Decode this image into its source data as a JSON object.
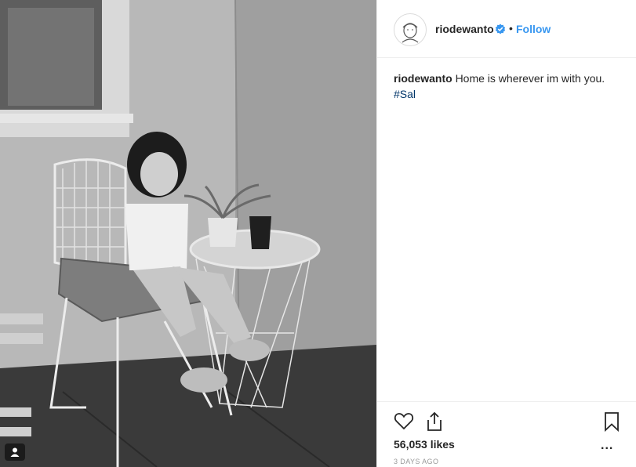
{
  "post": {
    "username": "riodewanto",
    "follow_label": "Follow",
    "separator": "•",
    "caption_text": "Home is wherever im with you.",
    "hashtag": "#Sal",
    "likes": "56,053 likes",
    "time_ago": "3 DAYS AGO",
    "more_label": "..."
  },
  "icons": {
    "verified": "verified-badge-icon",
    "like": "heart-icon",
    "share": "share-icon",
    "save": "bookmark-icon",
    "tag": "user-tag-icon"
  },
  "colors": {
    "link": "#3897f0",
    "hashtag": "#003569",
    "muted": "#999999",
    "text": "#262626"
  }
}
